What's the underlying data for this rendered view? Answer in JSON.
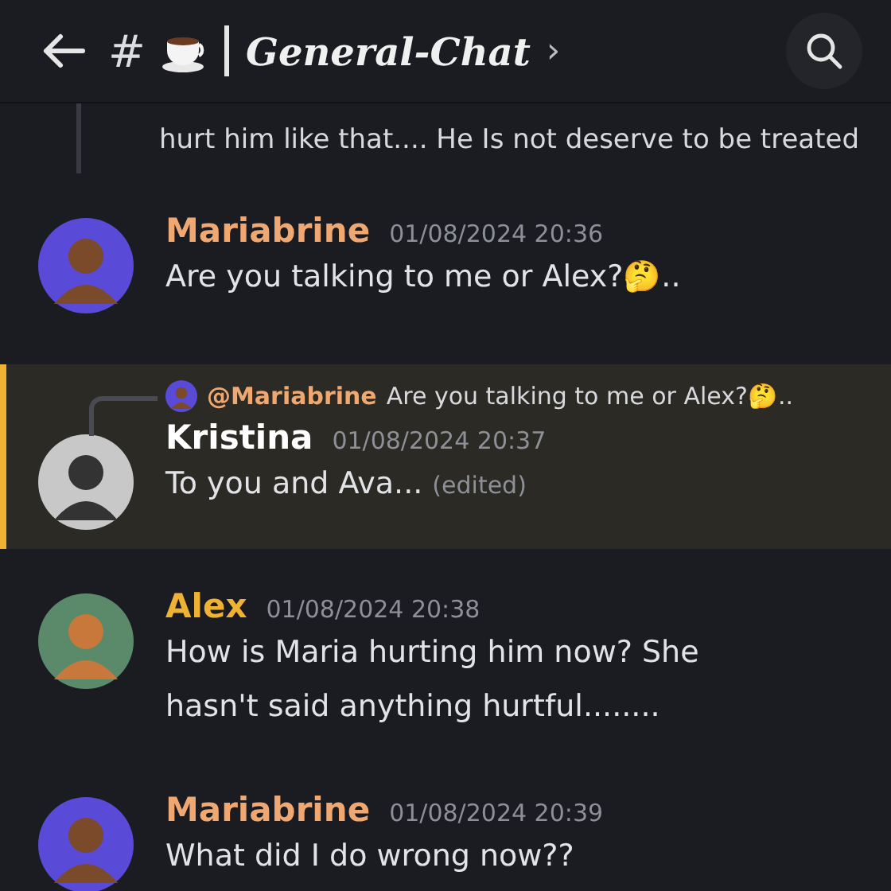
{
  "header": {
    "channel_prefix": "#",
    "channel_name": "General-Chat",
    "chevron": "›"
  },
  "messages": [
    {
      "kind": "continuation",
      "text": "hurt him like that.... He Is not deserve to be treated"
    },
    {
      "kind": "message",
      "author": "Mariabrine",
      "color": "#f0a872",
      "time": "01/08/2024 20:36",
      "text": "Are you talking to me or Alex?🤔..",
      "highlighted": false,
      "edited": false
    },
    {
      "kind": "message",
      "author": "Kristina",
      "color": "#ffffff",
      "time": "01/08/2024 20:37",
      "text": "To you and Ava...",
      "edited_label": "(edited)",
      "edited": true,
      "highlighted": true,
      "reply": {
        "author": "@Mariabrine",
        "color": "#f0a872",
        "text": "Are you talking to me or Alex?🤔.."
      }
    },
    {
      "kind": "message",
      "author": "Alex",
      "color": "#f0b232",
      "time": "01/08/2024 20:38",
      "text": "How is Maria hurting him now? She hasn't said anything hurtful........",
      "highlighted": false,
      "edited": false
    },
    {
      "kind": "message",
      "author": "Mariabrine",
      "color": "#f0a872",
      "time": "01/08/2024 20:39",
      "text": "What did I do wrong now??",
      "highlighted": false,
      "edited": false
    }
  ]
}
